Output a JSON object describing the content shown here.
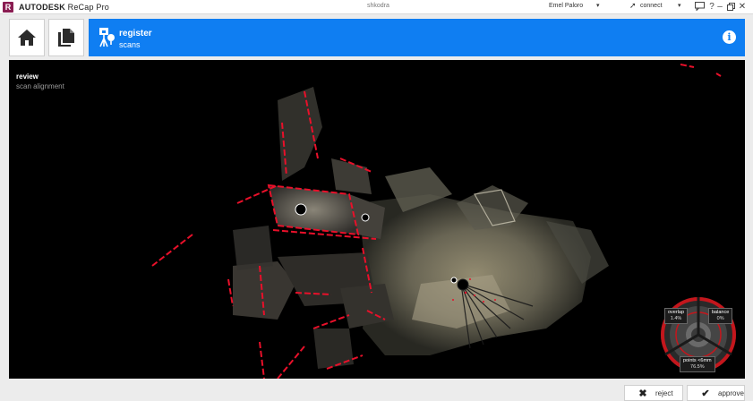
{
  "titlebar": {
    "logo": "R",
    "brand": "AUTODESK",
    "product": "ReCap Pro",
    "project": "shkodra",
    "user": "Emel Paloro",
    "connect": "connect",
    "icons": [
      "connect-icon",
      "cart-icon",
      "chat-icon",
      "help-icon",
      "minimize-icon",
      "restore-icon",
      "close-icon"
    ]
  },
  "header": {
    "home_icon": "home-icon",
    "projects_icon": "projects-icon",
    "mode_title": "register",
    "mode_subtitle": "scans",
    "mode_icon": "register-scans-icon",
    "info_icon": "info-icon",
    "accent_color": "#0f7ef2"
  },
  "viewport": {
    "label": "review",
    "sublabel": "scan alignment",
    "highlight_color": "#e8102a"
  },
  "gauge": {
    "overlap_label": "overlap",
    "overlap_value": "1.4%",
    "balance_label": "balance",
    "balance_value": "0%",
    "points_label": "points <6mm",
    "points_value": "76.5%",
    "ring_color": "#c4161c"
  },
  "actions": {
    "reject_label": "reject",
    "approve_label": "approve",
    "reject_icon": "x-icon",
    "approve_icon": "check-icon"
  }
}
